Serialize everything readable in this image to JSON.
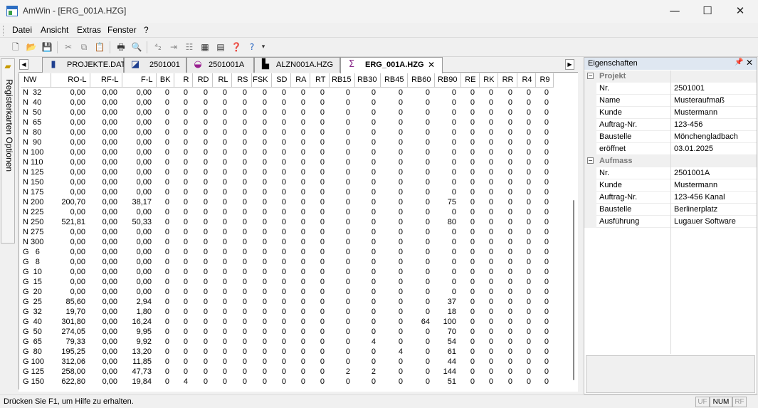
{
  "window": {
    "title": "AmWin - [ERG_001A.HZG]",
    "minimize_icon": "—",
    "maximize_icon": "☐",
    "close_icon": "✕"
  },
  "menu": [
    "Datei",
    "Ansicht",
    "Extras",
    "Fenster",
    "?"
  ],
  "toolbar": {
    "icons": [
      "new-file-icon",
      "open-folder-icon",
      "save-icon",
      "cut-icon",
      "copy-icon",
      "paste-icon",
      "print-icon",
      "print-preview-icon",
      "sort-icon",
      "indent-icon",
      "outline-icon",
      "grid-icon",
      "table-icon",
      "help-icon",
      "context-help-icon",
      "dropdown-arrow-icon"
    ],
    "glyphs": [
      "🗋",
      "📂",
      "💾",
      "✂",
      "⧉",
      "📋",
      "🖶",
      "🔍",
      "⁴₂",
      "⇥",
      "☷",
      "▦",
      "▤",
      "❓",
      "?",
      "▾"
    ]
  },
  "sidebar": {
    "tab_label": "Registerkarten Optionen"
  },
  "tabs": [
    {
      "label": "PROJEKTE.DAT",
      "icon": "database-icon",
      "glyph": "▮",
      "active": false
    },
    {
      "label": "2501001",
      "icon": "project-icon",
      "glyph": "◪",
      "active": false
    },
    {
      "label": "2501001A",
      "icon": "measurement-icon",
      "glyph": "◒",
      "active": false
    },
    {
      "label": "ALZN001A.HZG",
      "icon": "document-icon",
      "glyph": "▙",
      "active": false
    },
    {
      "label": "ERG_001A.HZG",
      "icon": "result-icon",
      "glyph": "Σ",
      "active": true
    }
  ],
  "tab_scroll": {
    "left": "◀",
    "right": "▶",
    "close": "✕"
  },
  "grid": {
    "columns": [
      "NW",
      "RO-L",
      "RF-L",
      "F-L",
      "BK",
      "R",
      "RD",
      "RL",
      "RS",
      "FSK",
      "SD",
      "RA",
      "RT",
      "RB15",
      "RB30",
      "RB45",
      "RB60",
      "RB90",
      "RE",
      "RK",
      "RR",
      "R4",
      "R9"
    ],
    "rows": [
      [
        "N  32",
        "0,00",
        "0,00",
        "0,00",
        "0",
        "0",
        "0",
        "0",
        "0",
        "0",
        "0",
        "0",
        "0",
        "0",
        "0",
        "0",
        "0",
        "0",
        "0",
        "0",
        "0",
        "0",
        "0"
      ],
      [
        "N  40",
        "0,00",
        "0,00",
        "0,00",
        "0",
        "0",
        "0",
        "0",
        "0",
        "0",
        "0",
        "0",
        "0",
        "0",
        "0",
        "0",
        "0",
        "0",
        "0",
        "0",
        "0",
        "0",
        "0"
      ],
      [
        "N  50",
        "0,00",
        "0,00",
        "0,00",
        "0",
        "0",
        "0",
        "0",
        "0",
        "0",
        "0",
        "0",
        "0",
        "0",
        "0",
        "0",
        "0",
        "0",
        "0",
        "0",
        "0",
        "0",
        "0"
      ],
      [
        "N  65",
        "0,00",
        "0,00",
        "0,00",
        "0",
        "0",
        "0",
        "0",
        "0",
        "0",
        "0",
        "0",
        "0",
        "0",
        "0",
        "0",
        "0",
        "0",
        "0",
        "0",
        "0",
        "0",
        "0"
      ],
      [
        "N  80",
        "0,00",
        "0,00",
        "0,00",
        "0",
        "0",
        "0",
        "0",
        "0",
        "0",
        "0",
        "0",
        "0",
        "0",
        "0",
        "0",
        "0",
        "0",
        "0",
        "0",
        "0",
        "0",
        "0"
      ],
      [
        "N  90",
        "0,00",
        "0,00",
        "0,00",
        "0",
        "0",
        "0",
        "0",
        "0",
        "0",
        "0",
        "0",
        "0",
        "0",
        "0",
        "0",
        "0",
        "0",
        "0",
        "0",
        "0",
        "0",
        "0"
      ],
      [
        "N 100",
        "0,00",
        "0,00",
        "0,00",
        "0",
        "0",
        "0",
        "0",
        "0",
        "0",
        "0",
        "0",
        "0",
        "0",
        "0",
        "0",
        "0",
        "0",
        "0",
        "0",
        "0",
        "0",
        "0"
      ],
      [
        "N 110",
        "0,00",
        "0,00",
        "0,00",
        "0",
        "0",
        "0",
        "0",
        "0",
        "0",
        "0",
        "0",
        "0",
        "0",
        "0",
        "0",
        "0",
        "0",
        "0",
        "0",
        "0",
        "0",
        "0"
      ],
      [
        "N 125",
        "0,00",
        "0,00",
        "0,00",
        "0",
        "0",
        "0",
        "0",
        "0",
        "0",
        "0",
        "0",
        "0",
        "0",
        "0",
        "0",
        "0",
        "0",
        "0",
        "0",
        "0",
        "0",
        "0"
      ],
      [
        "N 150",
        "0,00",
        "0,00",
        "0,00",
        "0",
        "0",
        "0",
        "0",
        "0",
        "0",
        "0",
        "0",
        "0",
        "0",
        "0",
        "0",
        "0",
        "0",
        "0",
        "0",
        "0",
        "0",
        "0"
      ],
      [
        "N 175",
        "0,00",
        "0,00",
        "0,00",
        "0",
        "0",
        "0",
        "0",
        "0",
        "0",
        "0",
        "0",
        "0",
        "0",
        "0",
        "0",
        "0",
        "0",
        "0",
        "0",
        "0",
        "0",
        "0"
      ],
      [
        "N 200",
        "200,70",
        "0,00",
        "38,17",
        "0",
        "0",
        "0",
        "0",
        "0",
        "0",
        "0",
        "0",
        "0",
        "0",
        "0",
        "0",
        "0",
        "75",
        "0",
        "0",
        "0",
        "0",
        "0"
      ],
      [
        "N 225",
        "0,00",
        "0,00",
        "0,00",
        "0",
        "0",
        "0",
        "0",
        "0",
        "0",
        "0",
        "0",
        "0",
        "0",
        "0",
        "0",
        "0",
        "0",
        "0",
        "0",
        "0",
        "0",
        "0"
      ],
      [
        "N 250",
        "521,81",
        "0,00",
        "50,33",
        "0",
        "0",
        "0",
        "0",
        "0",
        "0",
        "0",
        "0",
        "0",
        "0",
        "0",
        "0",
        "0",
        "80",
        "0",
        "0",
        "0",
        "0",
        "0"
      ],
      [
        "N 275",
        "0,00",
        "0,00",
        "0,00",
        "0",
        "0",
        "0",
        "0",
        "0",
        "0",
        "0",
        "0",
        "0",
        "0",
        "0",
        "0",
        "0",
        "0",
        "0",
        "0",
        "0",
        "0",
        "0"
      ],
      [
        "N 300",
        "0,00",
        "0,00",
        "0,00",
        "0",
        "0",
        "0",
        "0",
        "0",
        "0",
        "0",
        "0",
        "0",
        "0",
        "0",
        "0",
        "0",
        "0",
        "0",
        "0",
        "0",
        "0",
        "0"
      ],
      [
        "G   6",
        "0,00",
        "0,00",
        "0,00",
        "0",
        "0",
        "0",
        "0",
        "0",
        "0",
        "0",
        "0",
        "0",
        "0",
        "0",
        "0",
        "0",
        "0",
        "0",
        "0",
        "0",
        "0",
        "0"
      ],
      [
        "G   8",
        "0,00",
        "0,00",
        "0,00",
        "0",
        "0",
        "0",
        "0",
        "0",
        "0",
        "0",
        "0",
        "0",
        "0",
        "0",
        "0",
        "0",
        "0",
        "0",
        "0",
        "0",
        "0",
        "0"
      ],
      [
        "G  10",
        "0,00",
        "0,00",
        "0,00",
        "0",
        "0",
        "0",
        "0",
        "0",
        "0",
        "0",
        "0",
        "0",
        "0",
        "0",
        "0",
        "0",
        "0",
        "0",
        "0",
        "0",
        "0",
        "0"
      ],
      [
        "G  15",
        "0,00",
        "0,00",
        "0,00",
        "0",
        "0",
        "0",
        "0",
        "0",
        "0",
        "0",
        "0",
        "0",
        "0",
        "0",
        "0",
        "0",
        "0",
        "0",
        "0",
        "0",
        "0",
        "0"
      ],
      [
        "G  20",
        "0,00",
        "0,00",
        "0,00",
        "0",
        "0",
        "0",
        "0",
        "0",
        "0",
        "0",
        "0",
        "0",
        "0",
        "0",
        "0",
        "0",
        "0",
        "0",
        "0",
        "0",
        "0",
        "0"
      ],
      [
        "G  25",
        "85,60",
        "0,00",
        "2,94",
        "0",
        "0",
        "0",
        "0",
        "0",
        "0",
        "0",
        "0",
        "0",
        "0",
        "0",
        "0",
        "0",
        "37",
        "0",
        "0",
        "0",
        "0",
        "0"
      ],
      [
        "G  32",
        "19,70",
        "0,00",
        "1,80",
        "0",
        "0",
        "0",
        "0",
        "0",
        "0",
        "0",
        "0",
        "0",
        "0",
        "0",
        "0",
        "0",
        "18",
        "0",
        "0",
        "0",
        "0",
        "0"
      ],
      [
        "G  40",
        "301,80",
        "0,00",
        "16,24",
        "0",
        "0",
        "0",
        "0",
        "0",
        "0",
        "0",
        "0",
        "0",
        "0",
        "0",
        "0",
        "64",
        "100",
        "0",
        "0",
        "0",
        "0",
        "0"
      ],
      [
        "G  50",
        "274,05",
        "0,00",
        "9,95",
        "0",
        "0",
        "0",
        "0",
        "0",
        "0",
        "0",
        "0",
        "0",
        "0",
        "0",
        "0",
        "0",
        "70",
        "0",
        "0",
        "0",
        "0",
        "0"
      ],
      [
        "G  65",
        "79,33",
        "0,00",
        "9,92",
        "0",
        "0",
        "0",
        "0",
        "0",
        "0",
        "0",
        "0",
        "0",
        "0",
        "4",
        "0",
        "0",
        "54",
        "0",
        "0",
        "0",
        "0",
        "0"
      ],
      [
        "G  80",
        "195,25",
        "0,00",
        "13,20",
        "0",
        "0",
        "0",
        "0",
        "0",
        "0",
        "0",
        "0",
        "0",
        "0",
        "0",
        "4",
        "0",
        "61",
        "0",
        "0",
        "0",
        "0",
        "0"
      ],
      [
        "G 100",
        "312,06",
        "0,00",
        "11,85",
        "0",
        "0",
        "0",
        "0",
        "0",
        "0",
        "0",
        "0",
        "0",
        "0",
        "0",
        "0",
        "0",
        "44",
        "0",
        "0",
        "0",
        "0",
        "0"
      ],
      [
        "G 125",
        "258,00",
        "0,00",
        "47,73",
        "0",
        "0",
        "0",
        "0",
        "0",
        "0",
        "0",
        "0",
        "0",
        "2",
        "2",
        "0",
        "0",
        "144",
        "0",
        "0",
        "0",
        "0",
        "0"
      ],
      [
        "G 150",
        "622,80",
        "0,00",
        "19,84",
        "0",
        "4",
        "0",
        "0",
        "0",
        "0",
        "0",
        "0",
        "0",
        "0",
        "0",
        "0",
        "0",
        "51",
        "0",
        "0",
        "0",
        "0",
        "0"
      ]
    ]
  },
  "properties": {
    "title": "Eigenschaften",
    "pin_icon": "📌",
    "close_icon": "✕",
    "groups": [
      {
        "name": "Projekt",
        "expand_glyph": "−",
        "rows": [
          {
            "key": "Nr.",
            "value": "2501001"
          },
          {
            "key": "Name",
            "value": "Musteraufmaß"
          },
          {
            "key": "Kunde",
            "value": "Mustermann"
          },
          {
            "key": "Auftrag-Nr.",
            "value": "123-456"
          },
          {
            "key": "Baustelle",
            "value": "Mönchengladbach"
          },
          {
            "key": "eröffnet",
            "value": "03.01.2025"
          }
        ]
      },
      {
        "name": "Aufmass",
        "expand_glyph": "−",
        "rows": [
          {
            "key": "Nr.",
            "value": "2501001A"
          },
          {
            "key": "Kunde",
            "value": "Mustermann"
          },
          {
            "key": "Auftrag-Nr.",
            "value": "123-456 Kanal"
          },
          {
            "key": "Baustelle",
            "value": "Berlinerplatz"
          },
          {
            "key": "Ausführung",
            "value": "Lugauer Software"
          }
        ]
      }
    ]
  },
  "status": {
    "text": "Drücken Sie F1, um Hilfe zu erhalten.",
    "indicators": [
      {
        "label": "UF",
        "active": false
      },
      {
        "label": "NUM",
        "active": true
      },
      {
        "label": "RF",
        "active": false
      }
    ]
  }
}
